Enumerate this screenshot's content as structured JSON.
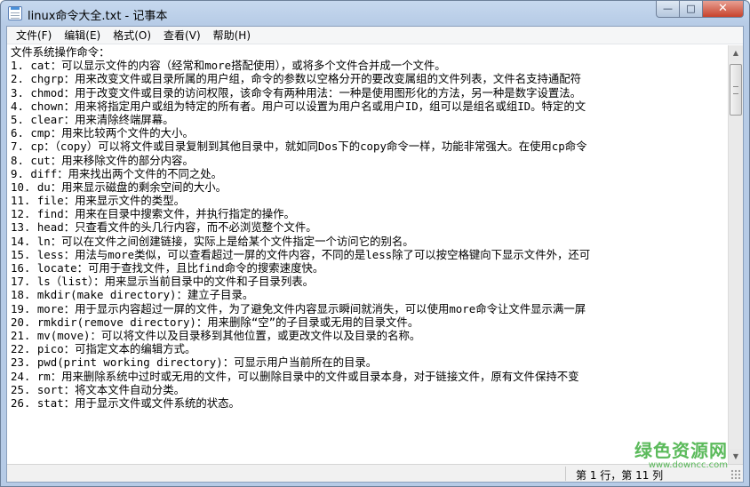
{
  "window": {
    "title": "linux命令大全.txt - 记事本",
    "icons": {
      "app": "notepad-icon",
      "minimize": "minimize-icon",
      "maximize": "maximize-icon",
      "close": "close-icon"
    },
    "minimize_glyph": "—",
    "maximize_glyph": "□",
    "close_glyph": "✕"
  },
  "menu": [
    {
      "label": "文件(F)"
    },
    {
      "label": "编辑(E)"
    },
    {
      "label": "格式(O)"
    },
    {
      "label": "查看(V)"
    },
    {
      "label": "帮助(H)"
    }
  ],
  "editor": {
    "lines": [
      "文件系统操作命令：",
      "1. cat：可以显示文件的内容（经常和more搭配使用），或将多个文件合并成一个文件。",
      "2. chgrp：用来改变文件或目录所属的用户组，命令的参数以空格分开的要改变属组的文件列表，文件名支持通配符",
      "3. chmod：用于改变文件或目录的访问权限，该命令有两种用法：一种是使用图形化的方法，另一种是数字设置法。",
      "4. chown：用来将指定用户或组为特定的所有者。用户可以设置为用户名或用户ID，组可以是组名或组ID。特定的文",
      "5. clear：用来清除终端屏幕。",
      "6. cmp：用来比较两个文件的大小。",
      "7. cp：（copy）可以将文件或目录复制到其他目录中，就如同Dos下的copy命令一样，功能非常强大。在使用cp命令",
      "8. cut：用来移除文件的部分内容。",
      "9. diff：用来找出两个文件的不同之处。",
      "10. du：用来显示磁盘的剩余空间的大小。",
      "11. file：用来显示文件的类型。",
      "12. find：用来在目录中搜索文件，并执行指定的操作。",
      "13. head：只查看文件的头几行内容，而不必浏览整个文件。",
      "14. ln：可以在文件之间创建链接，实际上是给某个文件指定一个访问它的别名。",
      "15. less：用法与more类似，可以查看超过一屏的文件内容，不同的是less除了可以按空格键向下显示文件外，还可",
      "16. locate：可用于查找文件，且比find命令的搜索速度快。",
      "17. ls（list）：用来显示当前目录中的文件和子目录列表。",
      "18. mkdir(make directory)：建立子目录。",
      "19. more：用于显示内容超过一屏的文件，为了避免文件内容显示瞬间就消失，可以使用more命令让文件显示满一屏",
      "20. rmkdir(remove directory)：用来删除“空”的子目录或无用的目录文件。",
      "21. mv(move)：可以将文件以及目录移到其他位置，或更改文件以及目录的名称。",
      "22. pico：可指定文本的编辑方式。",
      "23. pwd(print working directory)：可显示用户当前所在的目录。",
      "24. rm：用来删除系统中过时或无用的文件，可以删除目录中的文件或目录本身，对于链接文件，原有文件保持不变",
      "25. sort：将文本文件自动分类。",
      "26. stat：用于显示文件或文件系统的状态。"
    ]
  },
  "scrollbar": {
    "position": 0.0,
    "icons": {
      "up": "scroll-up-arrow-icon",
      "down": "scroll-down-arrow-icon"
    },
    "up_glyph": "▲",
    "down_glyph": "▼"
  },
  "status": {
    "position_text": "第 1 行，第 11 列"
  },
  "watermark": {
    "main": "绿色资源网",
    "sub": "www.downcc.com"
  }
}
